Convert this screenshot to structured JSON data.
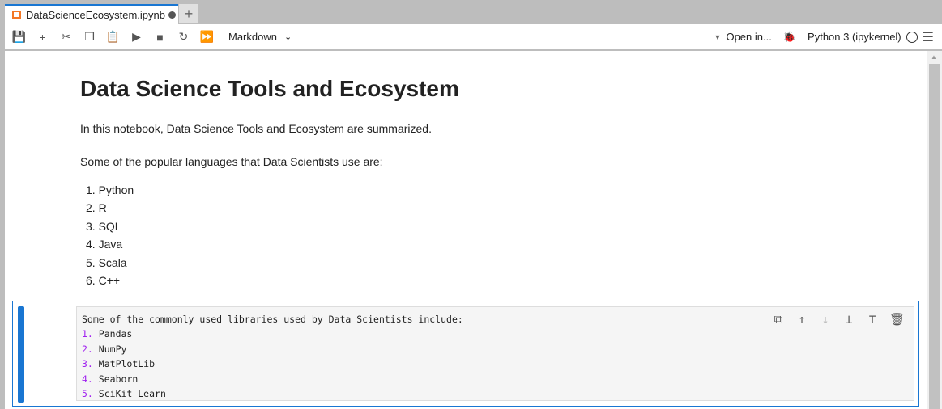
{
  "tab": {
    "title": "DataScienceEcosystem.ipynb",
    "new_tab": "+"
  },
  "toolbar": {
    "cell_type": "Markdown",
    "open_in": "Open in...",
    "kernel": "Python 3 (ipykernel)"
  },
  "notebook": {
    "heading": "Data Science Tools and Ecosystem",
    "intro": "In this notebook, Data Science Tools and Ecosystem are summarized.",
    "languages_intro": "Some of the popular languages that Data Scientists use are:",
    "languages": [
      "1. Python",
      "2. R",
      "3. SQL",
      "4. Java",
      "5. Scala",
      "6. C++"
    ],
    "editing_cell": {
      "first_line": "Some of the commonly used libraries used by Data Scientists include:",
      "items": [
        {
          "n": "1.",
          "t": "Pandas"
        },
        {
          "n": "2.",
          "t": "NumPy"
        },
        {
          "n": "3.",
          "t": "MatPlotLib"
        },
        {
          "n": "4.",
          "t": "Seaborn"
        },
        {
          "n": "5.",
          "t": "SciKit Learn"
        }
      ]
    }
  }
}
